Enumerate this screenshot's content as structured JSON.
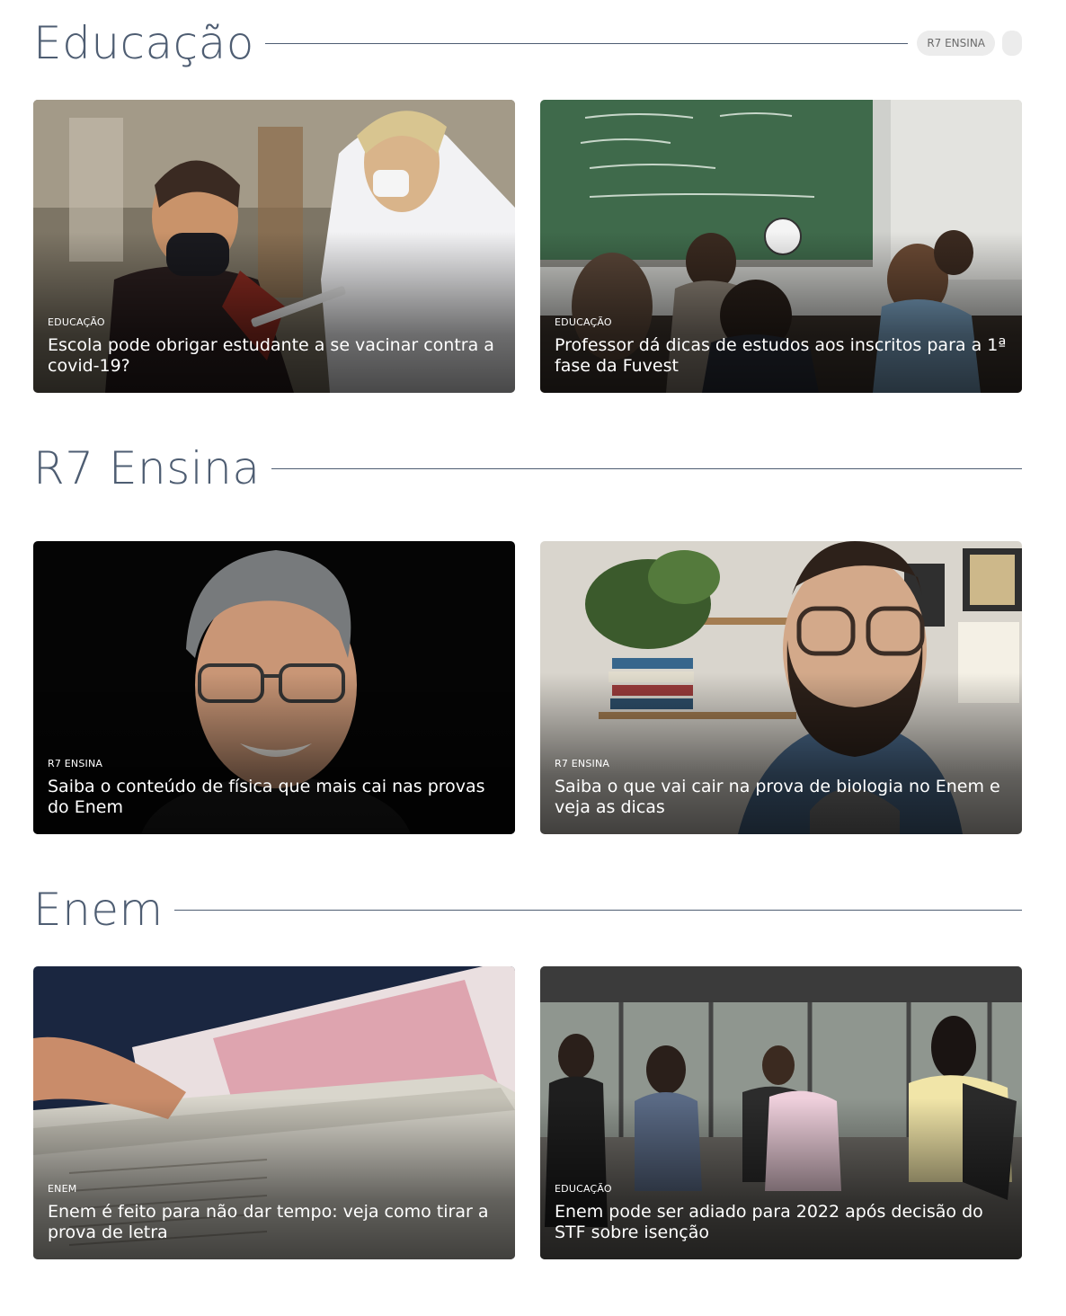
{
  "sections": [
    {
      "title": "Educação",
      "tags": [
        "R7 ENSINA"
      ],
      "cards": [
        {
          "category": "EDUCAÇÃO",
          "headline": "Escola pode obrigar estudante a se vacinar contra a covid-19?"
        },
        {
          "category": "EDUCAÇÃO",
          "headline": "Professor dá dicas de estudos aos inscritos para a 1ª fase da Fuvest"
        }
      ]
    },
    {
      "title": "R7 Ensina",
      "cards": [
        {
          "category": "R7 ENSINA",
          "headline": "Saiba o conteúdo de física que mais cai nas provas do Enem"
        },
        {
          "category": "R7 ENSINA",
          "headline": "Saiba o que vai cair na prova de biologia no Enem e veja as dicas"
        }
      ]
    },
    {
      "title": "Enem",
      "cards": [
        {
          "category": "ENEM",
          "headline": "Enem é feito para não dar tempo: veja como tirar a prova de letra"
        },
        {
          "category": "EDUCAÇÃO",
          "headline": "Enem pode ser adiado para 2022 após decisão do STF sobre isenção"
        }
      ]
    }
  ]
}
